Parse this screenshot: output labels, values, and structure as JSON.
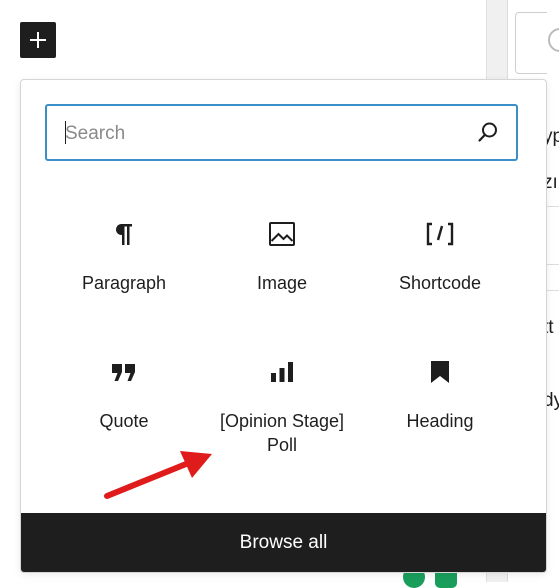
{
  "add_button": {
    "icon": "plus-icon"
  },
  "search": {
    "placeholder": "Search",
    "value": "",
    "icon": "search-icon"
  },
  "blocks": [
    {
      "label": "Paragraph",
      "icon": "paragraph-icon"
    },
    {
      "label": "Image",
      "icon": "image-icon"
    },
    {
      "label": "Shortcode",
      "icon": "shortcode-icon"
    },
    {
      "label": "Quote",
      "icon": "quote-icon"
    },
    {
      "label": "[Opinion Stage] Poll",
      "icon": "poll-icon"
    },
    {
      "label": "Heading",
      "icon": "bookmark-icon"
    }
  ],
  "browse_all": {
    "label": "Browse all"
  },
  "right_panel_fragments": [
    "yp",
    "zı",
    "tt",
    "dy"
  ],
  "annotation": {
    "arrow_color": "#e01b1b",
    "icon": "red-arrow-annotation"
  },
  "colors": {
    "dark": "#1e1e1e",
    "focus": "#3a8fc9",
    "annotation": "#e01b1b"
  }
}
